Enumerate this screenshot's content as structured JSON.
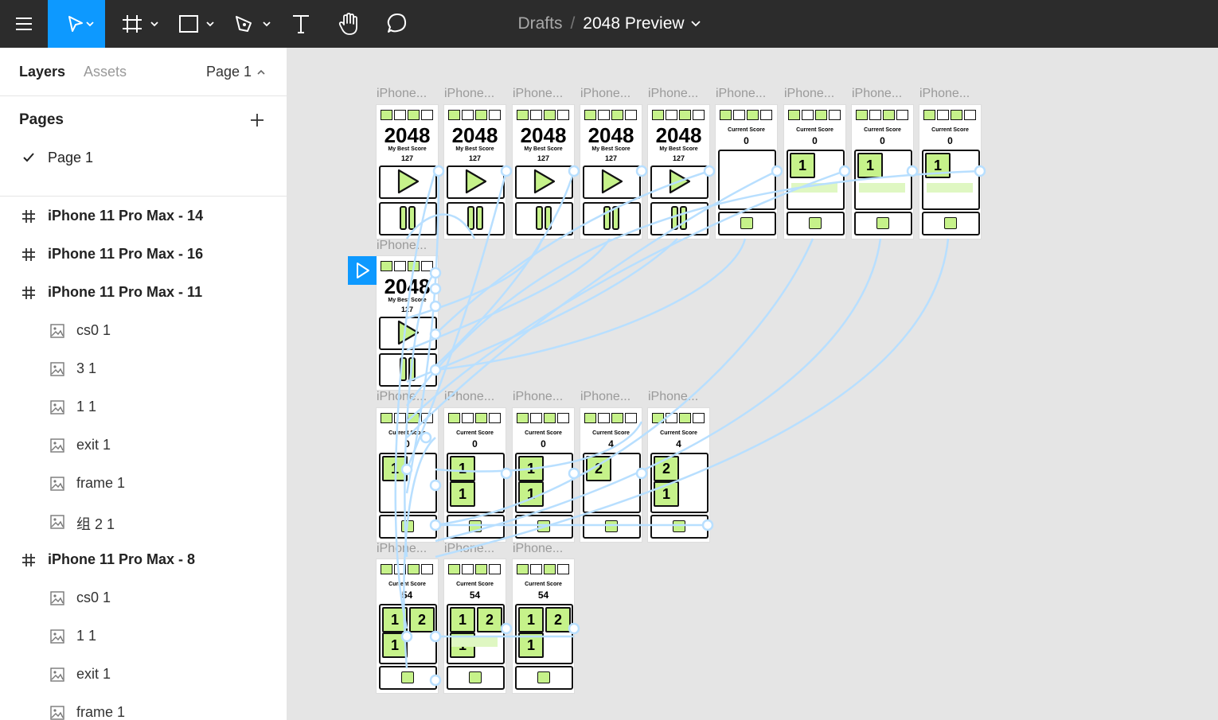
{
  "toolbar": {
    "tools": [
      "menu-icon",
      "move-tool-icon",
      "frame-tool-icon",
      "rectangle-tool-icon",
      "pen-tool-icon",
      "text-tool-icon",
      "hand-tool-icon",
      "comment-tool-icon"
    ],
    "active_tool": "move-tool-icon",
    "accent_color": "#0d99ff",
    "breadcrumb": {
      "location": "Drafts",
      "separator": "/",
      "file_name": "2048 Preview"
    }
  },
  "left_panel": {
    "tab_layers": "Layers",
    "tab_assets": "Assets",
    "current_page": "Page 1",
    "pages_heading": "Pages",
    "pages": [
      {
        "name": "Page 1",
        "selected": true
      }
    ],
    "layers": [
      {
        "type": "frame",
        "name": "iPhone 11 Pro Max - 14"
      },
      {
        "type": "frame",
        "name": "iPhone 11 Pro Max - 16"
      },
      {
        "type": "frame",
        "name": "iPhone 11 Pro Max - 11"
      },
      {
        "type": "image",
        "name": "cs0 1"
      },
      {
        "type": "image",
        "name": "3 1"
      },
      {
        "type": "image",
        "name": "1 1"
      },
      {
        "type": "image",
        "name": "exit 1"
      },
      {
        "type": "image",
        "name": "frame 1"
      },
      {
        "type": "image",
        "name": "组 2 1"
      },
      {
        "type": "frame",
        "name": "iPhone 11 Pro Max - 8"
      },
      {
        "type": "image",
        "name": "cs0 1"
      },
      {
        "type": "image",
        "name": "1 1"
      },
      {
        "type": "image",
        "name": "exit 1"
      },
      {
        "type": "image",
        "name": "frame 1"
      }
    ]
  },
  "canvas": {
    "frame_label": "iPhone...",
    "prototype_color": "#b8dfff",
    "menu_title": "2048",
    "best_label": "My Best Score",
    "best_value": "127",
    "current_label": "Current Score",
    "scores": {
      "zero": "0",
      "four": "4",
      "fiftyfour": "54"
    },
    "tiles": {
      "one": "1",
      "two": "2"
    }
  }
}
